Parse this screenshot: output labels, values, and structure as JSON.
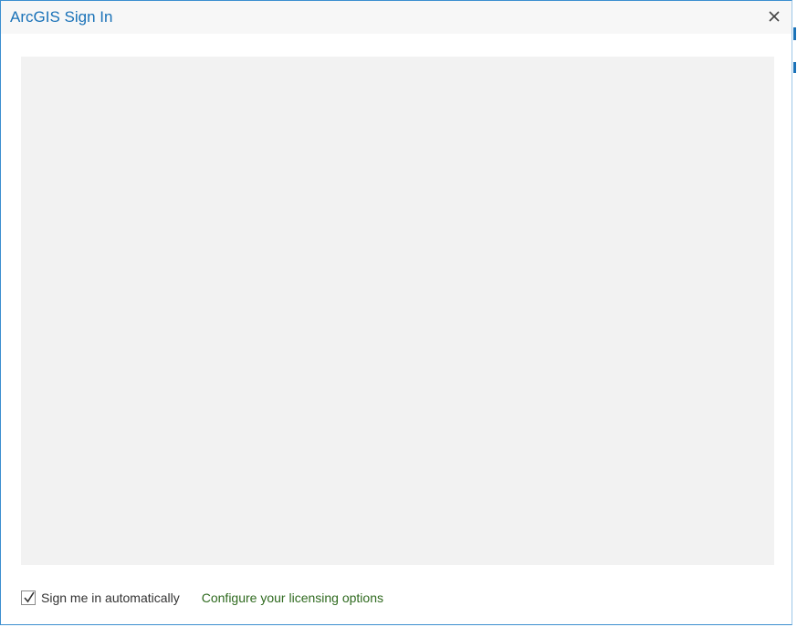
{
  "window": {
    "title": "ArcGIS Sign In",
    "close_icon": "close-icon"
  },
  "footer": {
    "auto_signin_label": "Sign me in automatically",
    "auto_signin_checked": true,
    "licensing_link": "Configure your licensing options"
  },
  "colors": {
    "title": "#1a72b8",
    "link": "#2f6a1f",
    "frame_background": "#f2f2f2",
    "border": "#3c8fd0"
  }
}
